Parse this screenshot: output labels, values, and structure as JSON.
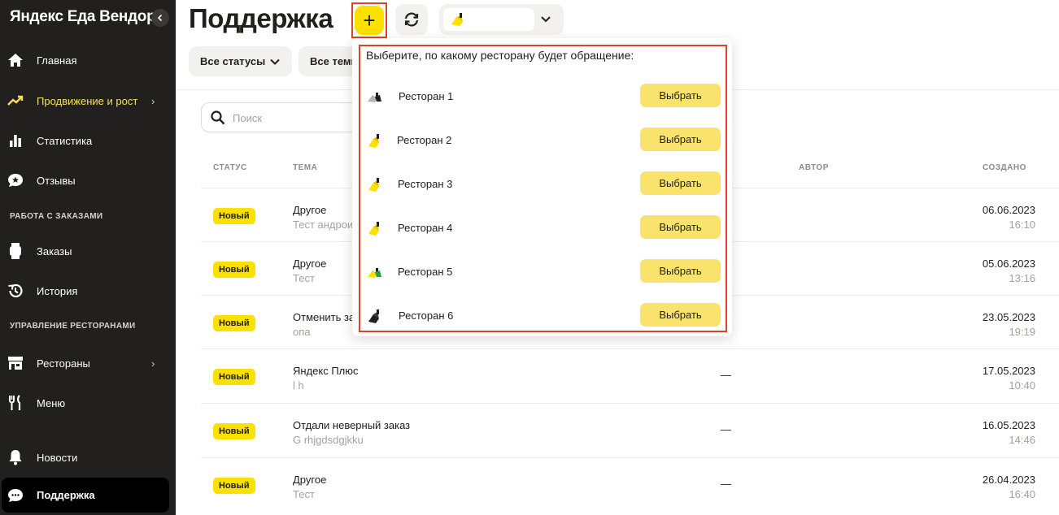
{
  "sidebar": {
    "brand": "Яндекс Еда Вендор",
    "items": [
      {
        "label": "Главная",
        "icon": "home-icon"
      },
      {
        "label": "Продвижение и рост",
        "icon": "trend-up-icon"
      },
      {
        "label": "Статистика",
        "icon": "bar-chart-icon"
      },
      {
        "label": "Отзывы",
        "icon": "chat-star-icon"
      },
      {
        "label": "Заказы",
        "icon": "watch-icon"
      },
      {
        "label": "История",
        "icon": "history-icon"
      },
      {
        "label": "Рестораны",
        "icon": "store-icon"
      },
      {
        "label": "Меню",
        "icon": "fork-knife-icon"
      },
      {
        "label": "Новости",
        "icon": "bell-icon"
      },
      {
        "label": "Поддержка",
        "icon": "support-chat-icon"
      }
    ],
    "sections": [
      "РАБОТА С ЗАКАЗАМИ",
      "УПРАВЛЕНИЕ РЕСТОРАНАМИ"
    ],
    "accent": "#f5e05a"
  },
  "header": {
    "title": "Поддержка",
    "add_label": "+"
  },
  "filters": {
    "status": "Все статусы",
    "topics": "Все темы"
  },
  "search": {
    "placeholder": "Поиск"
  },
  "table": {
    "headers": {
      "status": "СТАТУС",
      "topic": "ТЕМА",
      "author": "АВТОР",
      "created": "СОЗДАНО"
    },
    "rows": [
      {
        "status": "Новый",
        "topic": "Другое",
        "sub": "Тест андроид",
        "author": "",
        "date": "06.06.2023",
        "time": "16:10"
      },
      {
        "status": "Новый",
        "topic": "Другое",
        "sub": "Тест",
        "author": "",
        "date": "05.06.2023",
        "time": "13:16"
      },
      {
        "status": "Новый",
        "topic": "Отменить за",
        "sub": "опа",
        "author": "",
        "date": "23.05.2023",
        "time": "19:19"
      },
      {
        "status": "Новый",
        "topic": "Яндекс Плюс",
        "sub": "l h",
        "author": "—",
        "date": "17.05.2023",
        "time": "10:40"
      },
      {
        "status": "Новый",
        "topic": "Отдали неверный заказ",
        "sub": "G rhjgdsdgjkku",
        "author": "—",
        "date": "16.05.2023",
        "time": "14:46"
      },
      {
        "status": "Новый",
        "topic": "Другое",
        "sub": "Тест",
        "author": "—",
        "date": "26.04.2023",
        "time": "16:40"
      }
    ]
  },
  "popup": {
    "title": "Выберите, по какому ресторану будет обращение:",
    "choose_label": "Выбрать",
    "restaurants": [
      {
        "name": "Ресторан 1"
      },
      {
        "name": "Ресторан  2"
      },
      {
        "name": "Ресторан  3"
      },
      {
        "name": "Ресторан  4"
      },
      {
        "name": "Ресторан  5"
      },
      {
        "name": "Ресторан  6"
      }
    ]
  },
  "colors": {
    "brand_yellow": "#fce000",
    "highlight_red": "#d9442b",
    "sidebar_bg": "#21201f"
  }
}
